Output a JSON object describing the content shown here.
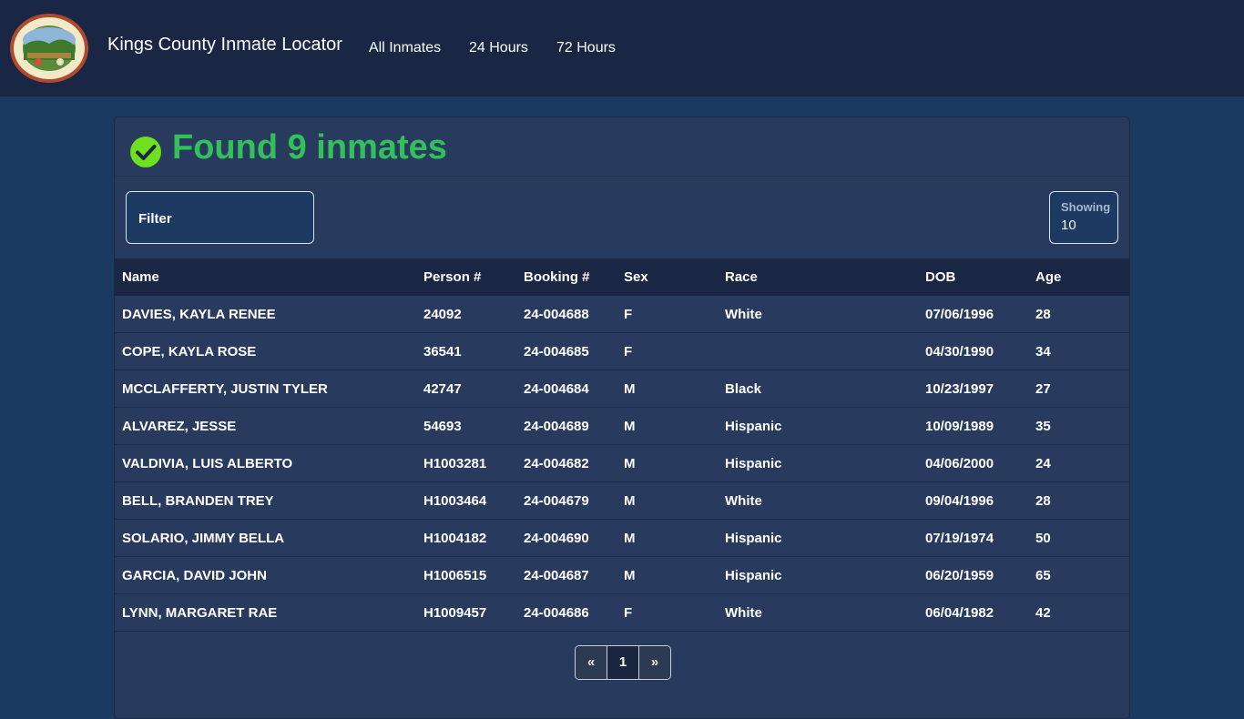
{
  "header": {
    "brand": "Kings County Inmate Locator",
    "seal_text": "COUNTY OF KINGS CALIFORNIA",
    "nav": [
      "All Inmates",
      "24 Hours",
      "72 Hours"
    ]
  },
  "results": {
    "title": "Found 9 inmates",
    "filter_label": "Filter",
    "showing_label": "Showing",
    "showing_value": "10"
  },
  "table": {
    "columns": [
      "Name",
      "Person #",
      "Booking #",
      "Sex",
      "Race",
      "DOB",
      "Age"
    ],
    "rows": [
      [
        "DAVIES, KAYLA RENEE",
        "24092",
        "24-004688",
        "F",
        "White",
        "07/06/1996",
        "28"
      ],
      [
        "COPE, KAYLA ROSE",
        "36541",
        "24-004685",
        "F",
        "",
        "04/30/1990",
        "34"
      ],
      [
        "MCCLAFFERTY, JUSTIN TYLER",
        "42747",
        "24-004684",
        "M",
        "Black",
        "10/23/1997",
        "27"
      ],
      [
        "ALVAREZ, JESSE",
        "54693",
        "24-004689",
        "M",
        "Hispanic",
        "10/09/1989",
        "35"
      ],
      [
        "VALDIVIA, LUIS ALBERTO",
        "H1003281",
        "24-004682",
        "M",
        "Hispanic",
        "04/06/2000",
        "24"
      ],
      [
        "BELL, BRANDEN TREY",
        "H1003464",
        "24-004679",
        "M",
        "White",
        "09/04/1996",
        "28"
      ],
      [
        "SOLARIO, JIMMY BELLA",
        "H1004182",
        "24-004690",
        "M",
        "Hispanic",
        "07/19/1974",
        "50"
      ],
      [
        "GARCIA, DAVID JOHN",
        "H1006515",
        "24-004687",
        "M",
        "Hispanic",
        "06/20/1959",
        "65"
      ],
      [
        "LYNN, MARGARET RAE",
        "H1009457",
        "24-004686",
        "F",
        "White",
        "06/04/1982",
        "42"
      ]
    ]
  },
  "pagination": {
    "prev": "«",
    "current": "1",
    "next": "»"
  },
  "colors": {
    "navbar": "#1a2744",
    "page_bg": "#1b3a5f",
    "card_bg": "#283a5e",
    "success": "#32c05a",
    "check_icon": "#6ee01f"
  },
  "icons": {
    "logo": "county-seal-icon",
    "title": "check-circle-icon"
  }
}
